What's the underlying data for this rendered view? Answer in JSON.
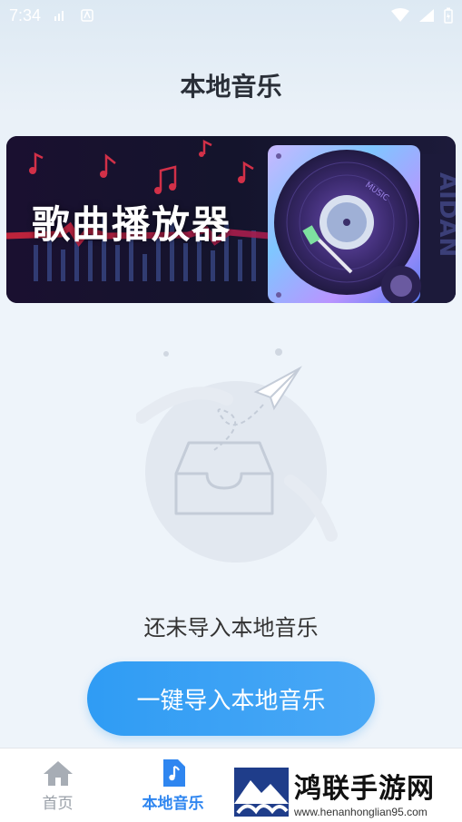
{
  "status_bar": {
    "time": "7:34"
  },
  "header": {
    "title": "本地音乐"
  },
  "banner": {
    "title": "歌曲播放器",
    "record_label": "MUSIC",
    "side_text": "AIDAN"
  },
  "empty_state": {
    "message": "还未导入本地音乐"
  },
  "actions": {
    "import_label": "一键导入本地音乐"
  },
  "tab_bar": {
    "items": [
      {
        "label": "首页",
        "icon": "home-icon",
        "active": false
      },
      {
        "label": "本地音乐",
        "icon": "music-note-icon",
        "active": true
      }
    ]
  },
  "watermark": {
    "brand_cn": "鸿联手游网",
    "brand_en": "www.henanhonglian95.com"
  },
  "colors": {
    "accent": "#2f9cf4",
    "tab_active": "#2f86f0",
    "title": "#2a2f38"
  }
}
